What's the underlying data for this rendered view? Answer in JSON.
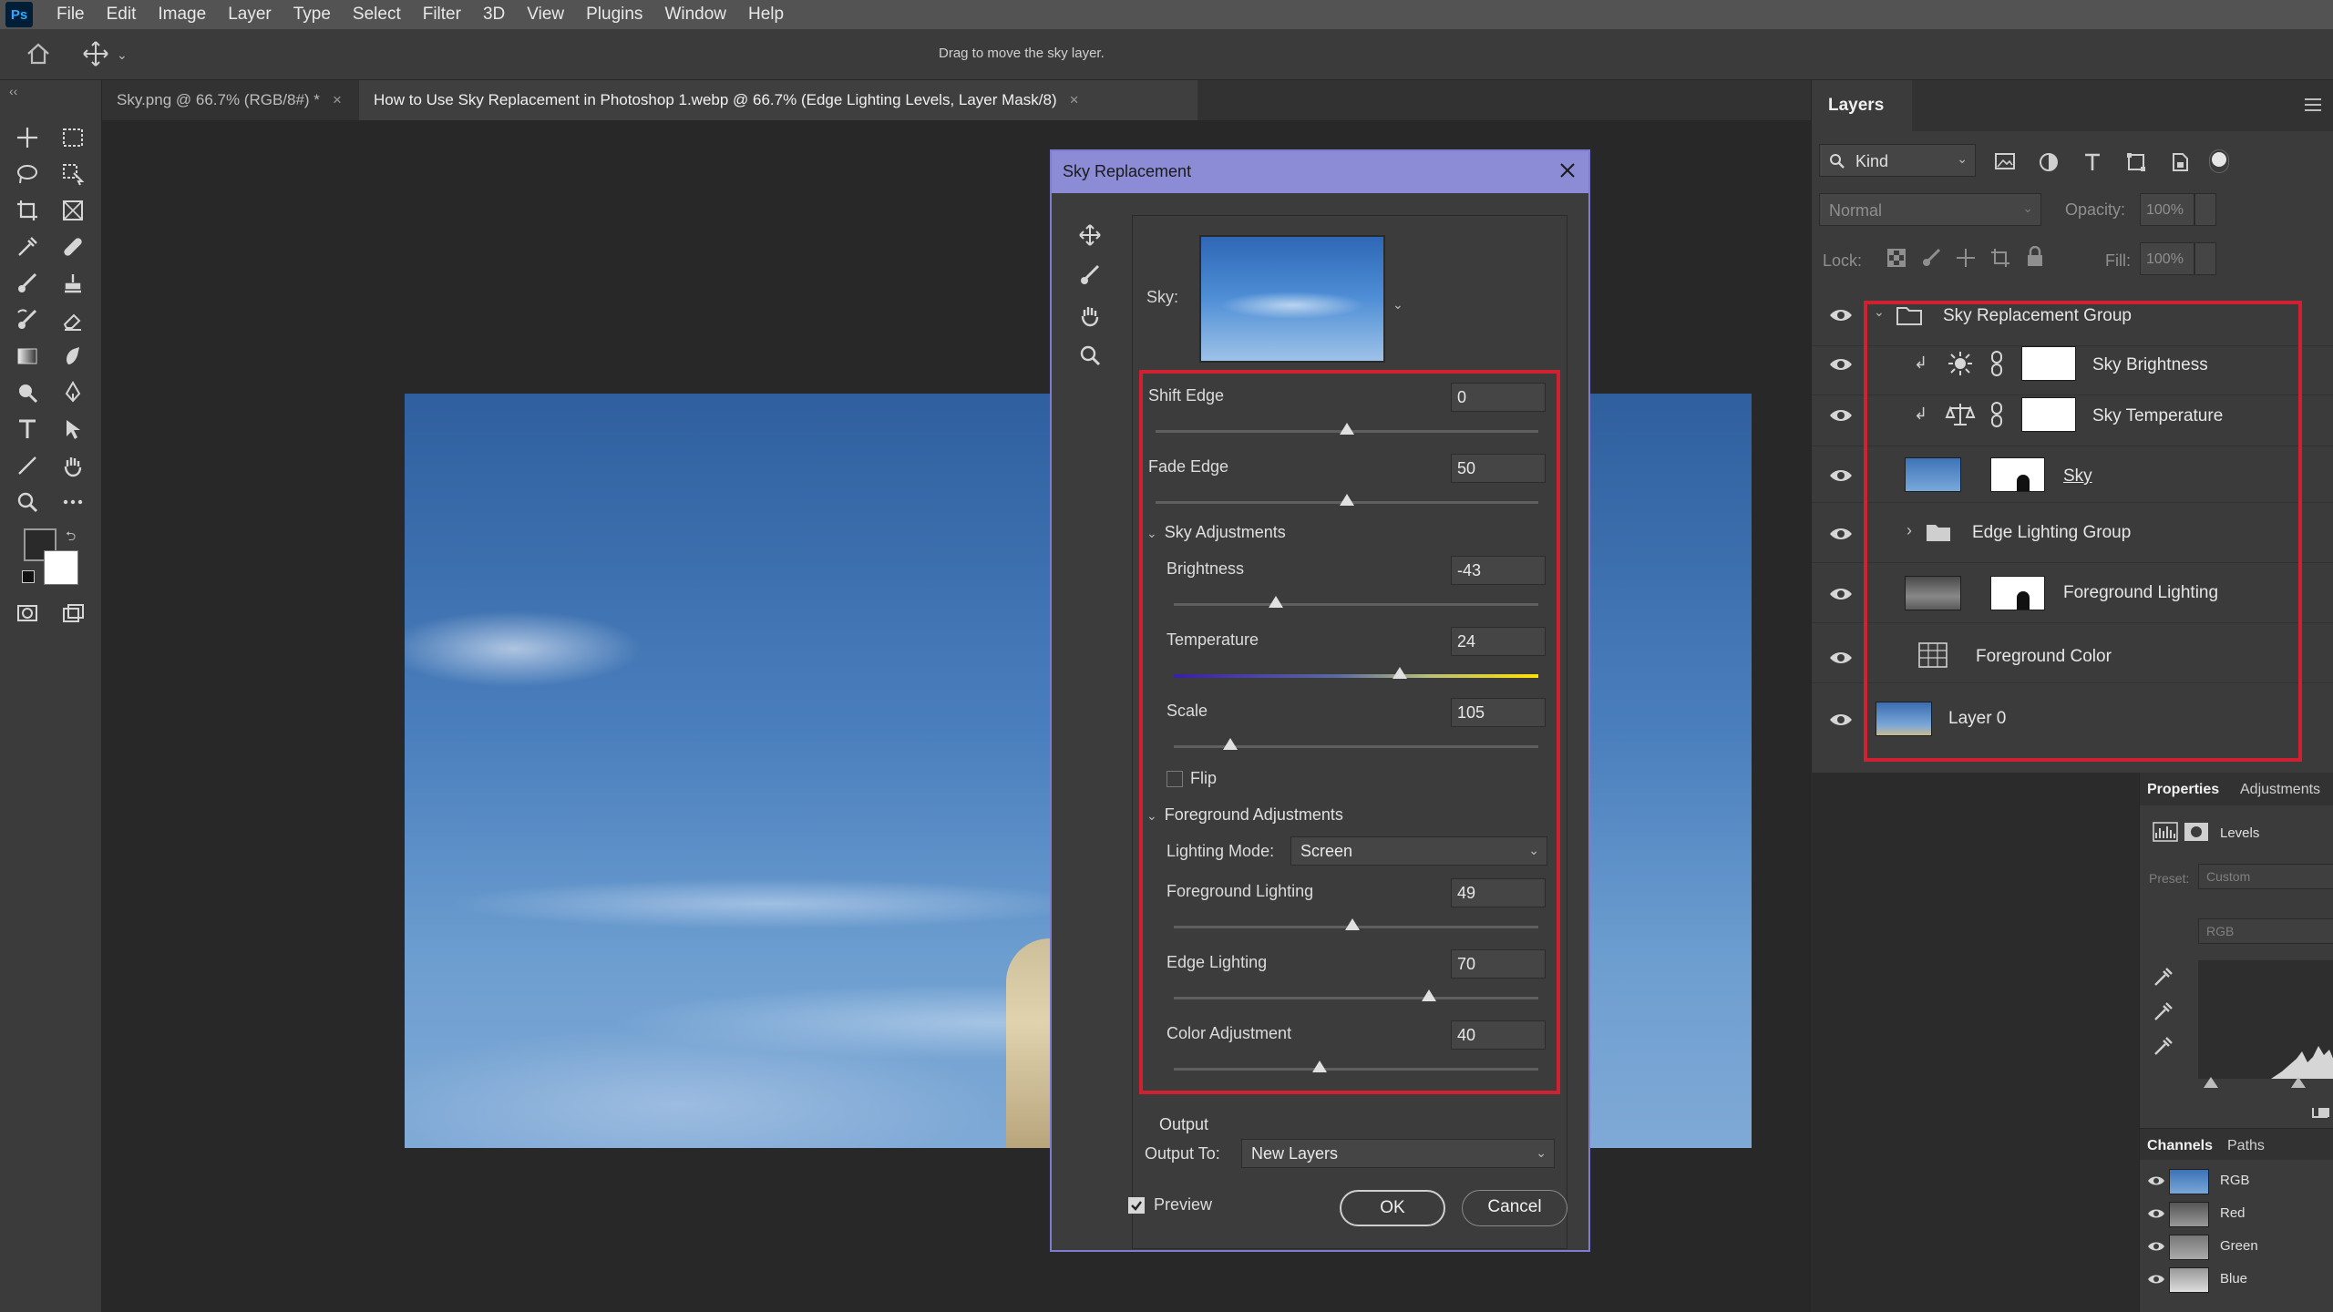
{
  "menu": {
    "logo": "Ps",
    "items": [
      "File",
      "Edit",
      "Image",
      "Layer",
      "Type",
      "Select",
      "Filter",
      "3D",
      "View",
      "Plugins",
      "Window",
      "Help"
    ]
  },
  "options": {
    "hint": "Drag to move the sky layer."
  },
  "tabs": [
    {
      "label": "Sky.png @ 66.7% (RGB/8#) *",
      "active": false
    },
    {
      "label": "How to Use Sky Replacement in Photoshop 1.webp @ 66.7% (Edge Lighting Levels, Layer Mask/8)",
      "active": true
    }
  ],
  "dialog": {
    "title": "Sky Replacement",
    "sky_label": "Sky:",
    "shift_edge": {
      "label": "Shift Edge",
      "value": "0",
      "level": 0.5
    },
    "fade_edge": {
      "label": "Fade Edge",
      "value": "50",
      "level": 0.5
    },
    "sky_adjustments": {
      "header": "Sky Adjustments",
      "brightness": {
        "label": "Brightness",
        "value": "-43",
        "level": 0.28
      },
      "temperature": {
        "label": "Temperature",
        "value": "24",
        "level": 0.62
      },
      "scale": {
        "label": "Scale",
        "value": "105",
        "level": 0.155
      },
      "flip_label": "Flip"
    },
    "foreground_adjustments": {
      "header": "Foreground Adjustments",
      "lighting_mode_label": "Lighting Mode:",
      "lighting_mode_value": "Screen",
      "foreground_lighting": {
        "label": "Foreground Lighting",
        "value": "49",
        "level": 0.49
      },
      "edge_lighting": {
        "label": "Edge Lighting",
        "value": "70",
        "level": 0.7
      },
      "color_adjustment": {
        "label": "Color Adjustment",
        "value": "40",
        "level": 0.4
      }
    },
    "output": {
      "header": "Output",
      "output_to_label": "Output To:",
      "output_to_value": "New Layers"
    },
    "preview_label": "Preview",
    "ok_label": "OK",
    "cancel_label": "Cancel"
  },
  "layers_panel": {
    "tab": "Layers",
    "kind_label": "Kind",
    "blend_mode": "Normal",
    "opacity_label": "Opacity:",
    "opacity_value": "100%",
    "lock_label": "Lock:",
    "fill_label": "Fill:",
    "fill_value": "100%",
    "layers": [
      {
        "name": "Sky Replacement Group",
        "type": "group-open"
      },
      {
        "name": "Sky Brightness",
        "type": "adjustment-brightness"
      },
      {
        "name": "Sky Temperature",
        "type": "adjustment-balance"
      },
      {
        "name": "Sky",
        "type": "image-mask"
      },
      {
        "name": "Edge Lighting Group",
        "type": "group-closed"
      },
      {
        "name": "Foreground Lighting",
        "type": "image-mask"
      },
      {
        "name": "Foreground Color",
        "type": "fill"
      },
      {
        "name": "Layer 0",
        "type": "image"
      }
    ],
    "highlight_color": "#d1202f"
  },
  "properties_panel": {
    "tabs": [
      "Properties",
      "Adjustments"
    ],
    "adjustment_name": "Levels",
    "preset_label": "Preset:",
    "preset_value": "Custom",
    "channel_value": "RGB"
  },
  "channels_panel": {
    "tabs": [
      "Channels",
      "Paths"
    ],
    "channels": [
      "RGB",
      "Red",
      "Green",
      "Blue"
    ]
  }
}
